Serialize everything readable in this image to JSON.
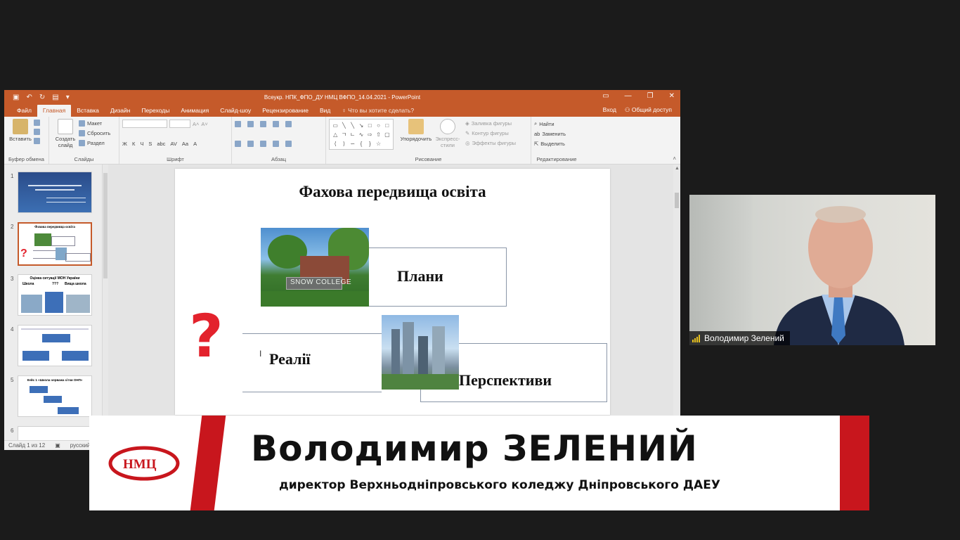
{
  "ppt": {
    "window_title": "Всеукр. НПК_ФПО_ДУ НМЦ ВФПО_14.04.2021 - PowerPoint",
    "tabs": [
      "Файл",
      "Главная",
      "Вставка",
      "Дизайн",
      "Переходы",
      "Анимация",
      "Слайд-шоу",
      "Рецензирование",
      "Вид"
    ],
    "tell_me": "Что вы хотите сделать?",
    "sign_in": "Вход",
    "share": "Общий доступ",
    "groups": {
      "clipboard": {
        "label": "Буфер обмена",
        "paste": "Вставить"
      },
      "slides": {
        "label": "Слайды",
        "new_slide_1": "Создать",
        "new_slide_2": "слайд",
        "layout": "Макет",
        "reset": "Сбросить",
        "section": "Раздел"
      },
      "font": {
        "label": "Шрифт",
        "bold": "Ж",
        "italic": "К",
        "underline": "Ч",
        "shadow": "S",
        "strike": "abc",
        "spacing": "AV",
        "case": "Aa",
        "color": "A"
      },
      "paragraph": {
        "label": "Абзац"
      },
      "drawing": {
        "label": "Рисование",
        "arrange": "Упорядочить",
        "quick_styles_1": "Экспресс-",
        "quick_styles_2": "стили",
        "fill": "Заливка фигуры",
        "outline": "Контур фигуры",
        "effects": "Эффекты фигуры"
      },
      "editing": {
        "label": "Редактирование",
        "find": "Найти",
        "replace": "Заменить",
        "select": "Выделить"
      }
    },
    "thumbnails": [
      {
        "num": "1"
      },
      {
        "num": "2",
        "title": "Фахова передвища освіта",
        "question": "?"
      },
      {
        "num": "3",
        "title": "Оцінка ситуації МОН України",
        "label_a": "Школа",
        "label_b": "???",
        "label_c": "Вища школа"
      },
      {
        "num": "4"
      },
      {
        "num": "5",
        "title": "Кейс 1 «Школа черважа сітки ОНП»"
      },
      {
        "num": "6"
      }
    ],
    "slide": {
      "title": "Фахова передвища освіта",
      "box_plans": "Плани",
      "box_reality": "Реалії",
      "box_prospects": "Перспективи",
      "question": "?",
      "photo_caption": "SNOW COLLEGE"
    },
    "status": {
      "slide_of": "Слайд 1 из 12",
      "language": "русский"
    }
  },
  "camera": {
    "participant_name": "Володимир Зелений"
  },
  "banner": {
    "logo_text": "НМЦ",
    "name": "Володимир ЗЕЛЕНИЙ",
    "position": "директор Верхньодніпровського коледжу Дніпровського ДАЕУ",
    "accent_color": "#c8161d"
  }
}
